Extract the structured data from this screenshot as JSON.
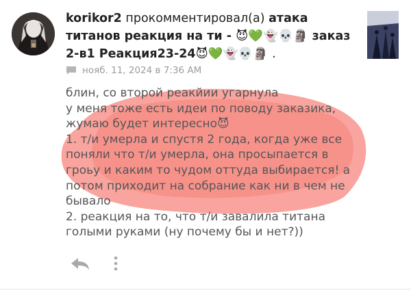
{
  "notification": {
    "username": "korikor2",
    "action_text": "прокомментировал(а)",
    "post_title_part1": "атака титанов реакция на ти -",
    "title_emojis_1": "😈💚👻💀🗿",
    "post_title_part2": "заказ 2-в1 Реакция23-24",
    "title_emojis_2": "😈💚👻💀🗿",
    "title_end": ".",
    "timestamp": "нояб. 11, 2024 в 7:36 AM"
  },
  "comment": {
    "lines": [
      "блин, со второй реакйии угарнула",
      "у меня тоже есть идеи по поводу заказика,",
      "жумаю будет интересно😈",
      "1. т/и умерла и спустя 2 года, когда уже все",
      "поняли что т/и умерла, она просыпается в",
      "гроьу и каким то чудом оттуда выбирается! а",
      "потом приходит на собрание как ни в чем не",
      "бывало",
      "2. реакция на то, что т/и завалила титана",
      "голыми руками (ну почему бы и нет?))"
    ]
  },
  "colors": {
    "highlight": "#f45a4e",
    "meta_gray": "#9b9b9b",
    "body_text": "#555555"
  },
  "icons": {
    "meta": "comment-icon",
    "reply": "reply-arrow-icon",
    "more": "more-vertical-icon"
  }
}
